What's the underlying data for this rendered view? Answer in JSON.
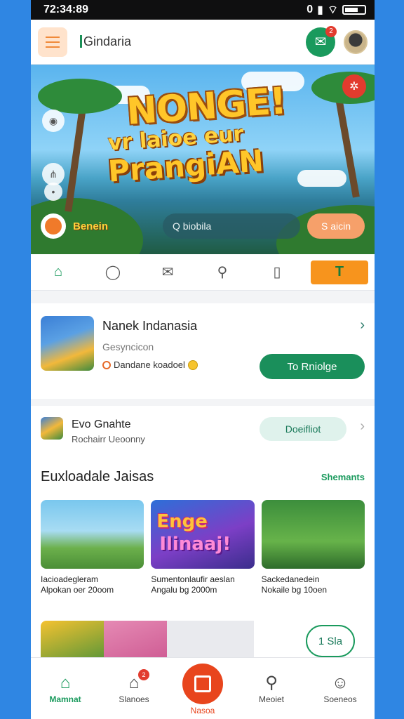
{
  "status_bar": {
    "time": "72:34:89",
    "signal_label": "0"
  },
  "app_bar": {
    "title": "Gindaria",
    "mail_badge": "2"
  },
  "banner": {
    "title": "NONGE!",
    "line1": "vr laioe eur",
    "line2": "PrangiAN",
    "label": "Benein",
    "input_value": "Q biobila",
    "button": "S aicin"
  },
  "tabs": [
    {
      "icon": "home-icon"
    },
    {
      "icon": "chat-icon"
    },
    {
      "icon": "mail-icon"
    },
    {
      "icon": "search-icon"
    },
    {
      "icon": "book-icon"
    },
    {
      "icon": "text-icon",
      "label": "T"
    }
  ],
  "featured": {
    "title": "Nanek Indanasia",
    "subtitle": "Gesyncicon",
    "meta": "Dandane koadoel",
    "button": "To Rniolge"
  },
  "secondary": {
    "title": "Evo Gnahte",
    "subtitle": "Rochairr Ueoonny",
    "button": "Doeifliot"
  },
  "section": {
    "title": "Euxloadale Jaisas",
    "see_all": "Shemants",
    "games": [
      {
        "name_line1": "Iacioadegleram",
        "name_line2": "Alpokan oer 20oom",
        "art_title": ""
      },
      {
        "name_line1": "Sumentonlaufir aeslan",
        "name_line2": "Angalu bg 2000m",
        "art_title": "Enge",
        "art_sub": "Ilinaaj!"
      },
      {
        "name_line1": "Sackedanedein",
        "name_line2": "Nokaile bg 10oen",
        "art_title": ""
      }
    ],
    "row2_button": "1 Sla"
  },
  "bottom_nav": [
    {
      "label": "Mamnat",
      "icon": "home-icon"
    },
    {
      "label": "Slanoes",
      "icon": "store-icon",
      "badge": "2"
    },
    {
      "label": "Nasoa",
      "icon": "square-icon"
    },
    {
      "label": "Meoiet",
      "icon": "profile-search-icon"
    },
    {
      "label": "Soeneos",
      "icon": "user-icon"
    }
  ]
}
